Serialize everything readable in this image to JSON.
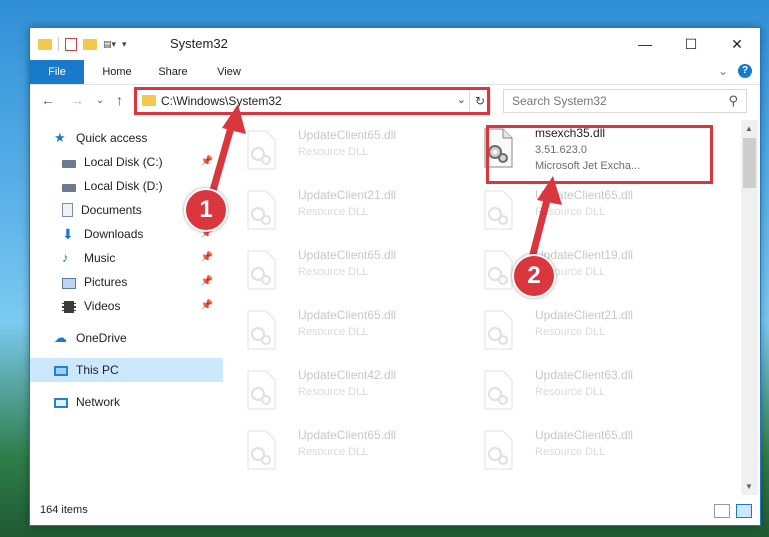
{
  "window": {
    "title": "System32",
    "controls": {
      "minimize": "—",
      "maximize": "☐",
      "close": "✕"
    }
  },
  "ribbon": {
    "tabs": [
      "File",
      "Home",
      "Share",
      "View"
    ],
    "collapse": "⌄",
    "help": "?"
  },
  "nav": {
    "back": "←",
    "forward": "→",
    "recent": "⌄",
    "up": "↑",
    "address": "C:\\Windows\\System32",
    "address_chevron": "⌄",
    "refresh": "↻",
    "search_placeholder": "Search System32",
    "search_icon": "⚲"
  },
  "sidebar": {
    "items": [
      {
        "label": "Quick access",
        "icon": "star-icon"
      },
      {
        "label": "Local Disk (C:)",
        "icon": "drive-icon",
        "pinned": true
      },
      {
        "label": "Local Disk (D:)",
        "icon": "drive-icon"
      },
      {
        "label": "Documents",
        "icon": "documents-icon",
        "pinned": true
      },
      {
        "label": "Downloads",
        "icon": "download-icon",
        "pinned": true
      },
      {
        "label": "Music",
        "icon": "music-icon",
        "pinned": true
      },
      {
        "label": "Pictures",
        "icon": "pictures-icon",
        "pinned": true
      },
      {
        "label": "Videos",
        "icon": "videos-icon",
        "pinned": true
      },
      {
        "label": "OneDrive",
        "icon": "cloud-icon"
      },
      {
        "label": "This PC",
        "icon": "computer-icon",
        "selected": true
      },
      {
        "label": "Network",
        "icon": "network-icon"
      }
    ],
    "pin_glyph": "📌"
  },
  "files": {
    "left": [
      {
        "name": "UpdateClient65.dll",
        "type": "Resource DLL"
      },
      {
        "name": "UpdateClient21.dll",
        "type": "Resource DLL"
      },
      {
        "name": "UpdateClient65.dll",
        "type": "Resource DLL"
      },
      {
        "name": "UpdateClient65.dll",
        "type": "Resource DLL"
      },
      {
        "name": "UpdateClient42.dll",
        "type": "Resource DLL"
      },
      {
        "name": "UpdateClient65.dll",
        "type": "Resource DLL"
      }
    ],
    "right_highlight": {
      "name": "msexch35.dll",
      "version": "3.51.623.0",
      "description": "Microsoft Jet Excha..."
    },
    "right": [
      {
        "name": "UpdateClient65.dll",
        "type": "Resource DLL"
      },
      {
        "name": "UpdateClient19.dll",
        "type": "Resource DLL"
      },
      {
        "name": "UpdateClient21.dll",
        "type": "Resource DLL"
      },
      {
        "name": "UpdateClient63.dll",
        "type": "Resource DLL"
      },
      {
        "name": "UpdateClient65.dll",
        "type": "Resource DLL"
      }
    ]
  },
  "status": {
    "count": "164 items"
  },
  "annotations": {
    "step1": "1",
    "step2": "2"
  },
  "colors": {
    "accent": "#1979ca",
    "annotation": "#d9363e",
    "selected_bg": "#cce8ff"
  }
}
